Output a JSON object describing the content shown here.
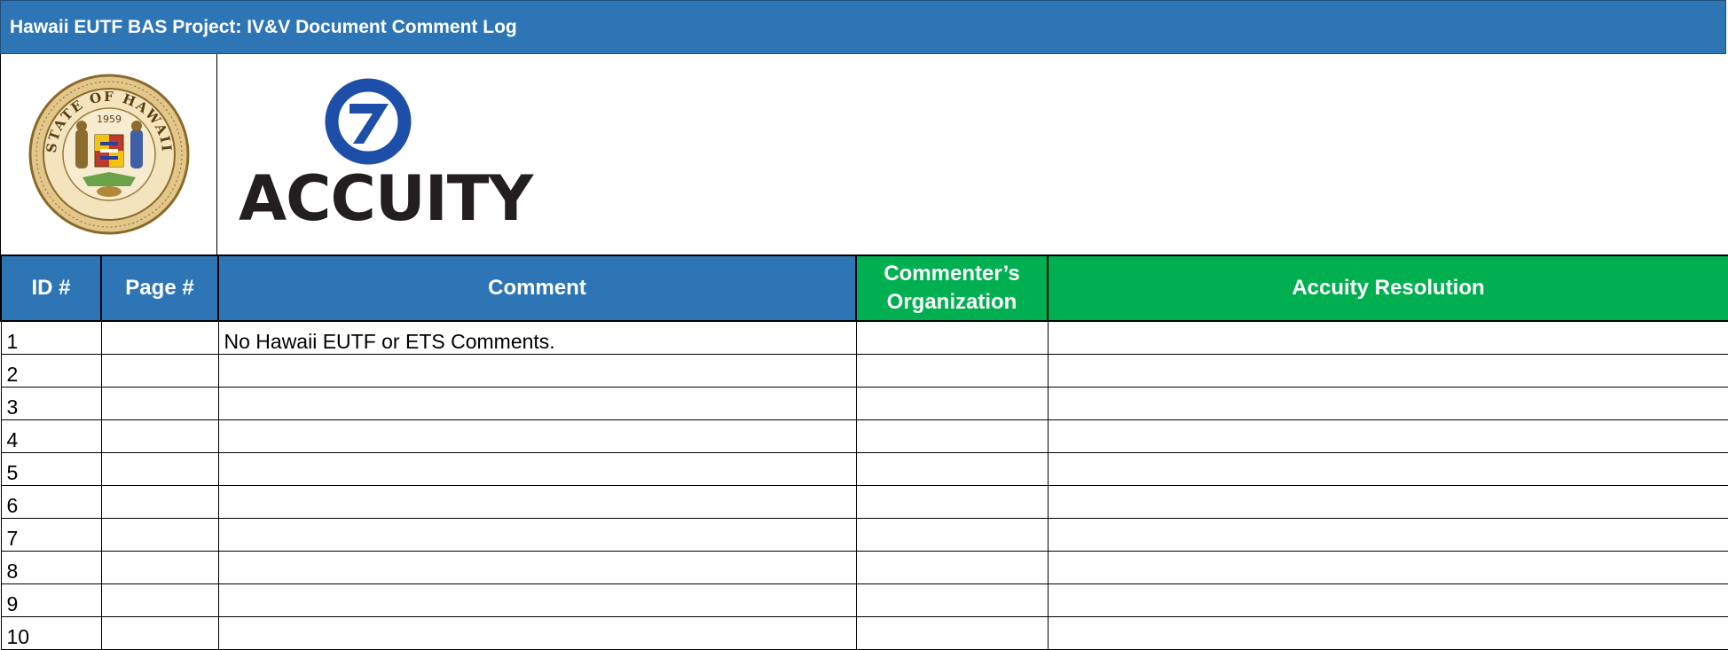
{
  "header": {
    "title": "Hawaii EUTF BAS Project:  IV&V Document Comment Log"
  },
  "logos": {
    "state_seal": {
      "icon": "state-of-hawaii-seal-icon",
      "top_text": "STATE OF HAWAII",
      "year": "1959"
    },
    "vendor": {
      "icon": "accuity-logo-icon",
      "wordmark": "ACCUITY"
    }
  },
  "colors": {
    "header_blue": "#2e75b6",
    "header_green": "#00b050"
  },
  "table": {
    "columns": [
      {
        "label": "ID #",
        "style": "blue"
      },
      {
        "label": "Page #",
        "style": "blue"
      },
      {
        "label": "Comment",
        "style": "blue"
      },
      {
        "label": "Commenter’s Organization",
        "style": "green"
      },
      {
        "label": "Accuity Resolution",
        "style": "green"
      }
    ],
    "rows": [
      [
        "1",
        "",
        "No Hawaii EUTF or ETS Comments.",
        "",
        ""
      ],
      [
        "2",
        "",
        "",
        "",
        ""
      ],
      [
        "3",
        "",
        "",
        "",
        ""
      ],
      [
        "4",
        "",
        "",
        "",
        ""
      ],
      [
        "5",
        "",
        "",
        "",
        ""
      ],
      [
        "6",
        "",
        "",
        "",
        ""
      ],
      [
        "7",
        "",
        "",
        "",
        ""
      ],
      [
        "8",
        "",
        "",
        "",
        ""
      ],
      [
        "9",
        "",
        "",
        "",
        ""
      ],
      [
        "10",
        "",
        "",
        "",
        ""
      ]
    ]
  }
}
